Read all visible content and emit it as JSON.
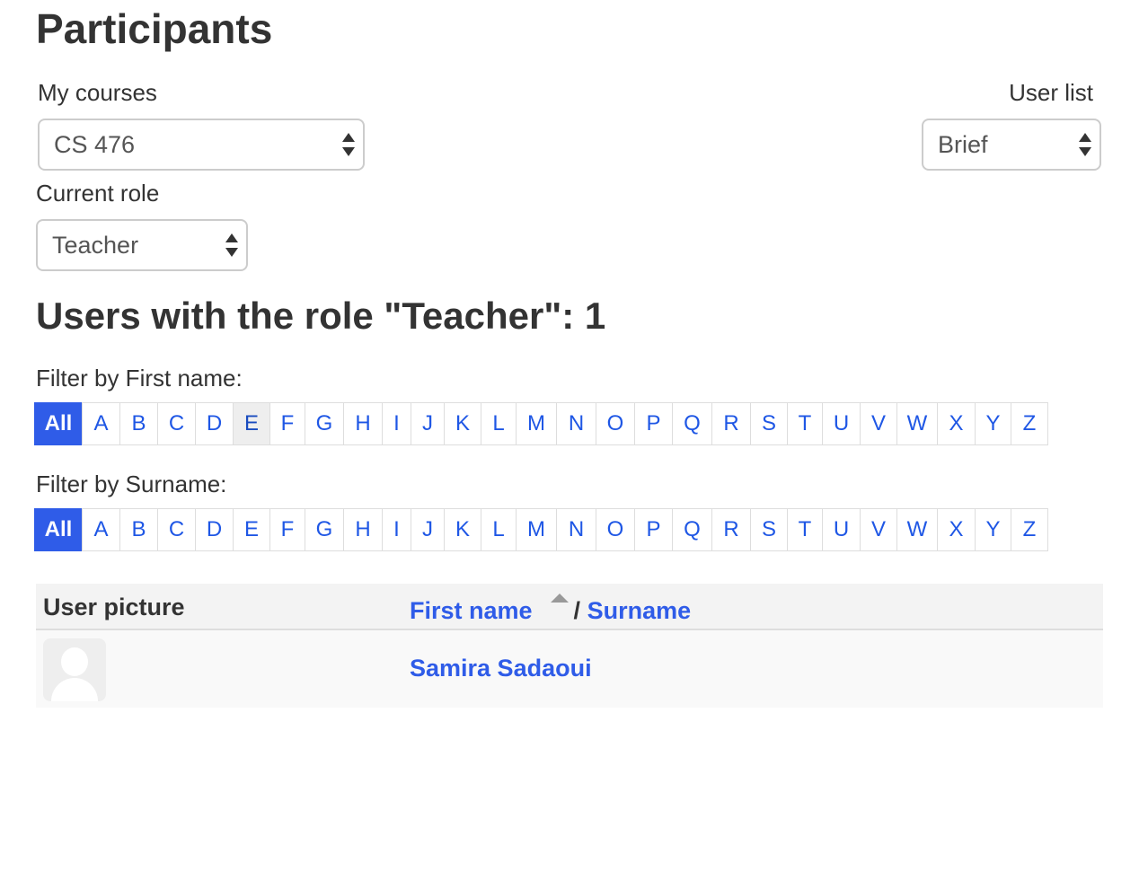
{
  "page_title": "Participants",
  "my_courses": {
    "label": "My courses",
    "selected": "CS 476"
  },
  "user_list": {
    "label": "User list",
    "selected": "Brief"
  },
  "current_role": {
    "label": "Current role",
    "selected": "Teacher"
  },
  "section_heading": "Users with the role \"Teacher\": 1",
  "first_name_filter": {
    "label": "Filter by First name:",
    "letters": [
      "All",
      "A",
      "B",
      "C",
      "D",
      "E",
      "F",
      "G",
      "H",
      "I",
      "J",
      "K",
      "L",
      "M",
      "N",
      "O",
      "P",
      "Q",
      "R",
      "S",
      "T",
      "U",
      "V",
      "W",
      "X",
      "Y",
      "Z"
    ],
    "active": "All",
    "hovered": "E"
  },
  "surname_filter": {
    "label": "Filter by Surname:",
    "letters": [
      "All",
      "A",
      "B",
      "C",
      "D",
      "E",
      "F",
      "G",
      "H",
      "I",
      "J",
      "K",
      "L",
      "M",
      "N",
      "O",
      "P",
      "Q",
      "R",
      "S",
      "T",
      "U",
      "V",
      "W",
      "X",
      "Y",
      "Z"
    ],
    "active": "All"
  },
  "table": {
    "headers": {
      "user_picture": "User picture",
      "first_name": "First name",
      "separator": "/",
      "surname": "Surname"
    },
    "sort_icon": "sort-ascending-icon",
    "rows": [
      {
        "name": "Samira Sadaoui",
        "picture": "default-user-avatar-icon"
      }
    ]
  },
  "colors": {
    "link": "#2f5ce8",
    "active_filter_bg": "#2f5ce8",
    "text": "#333333"
  }
}
